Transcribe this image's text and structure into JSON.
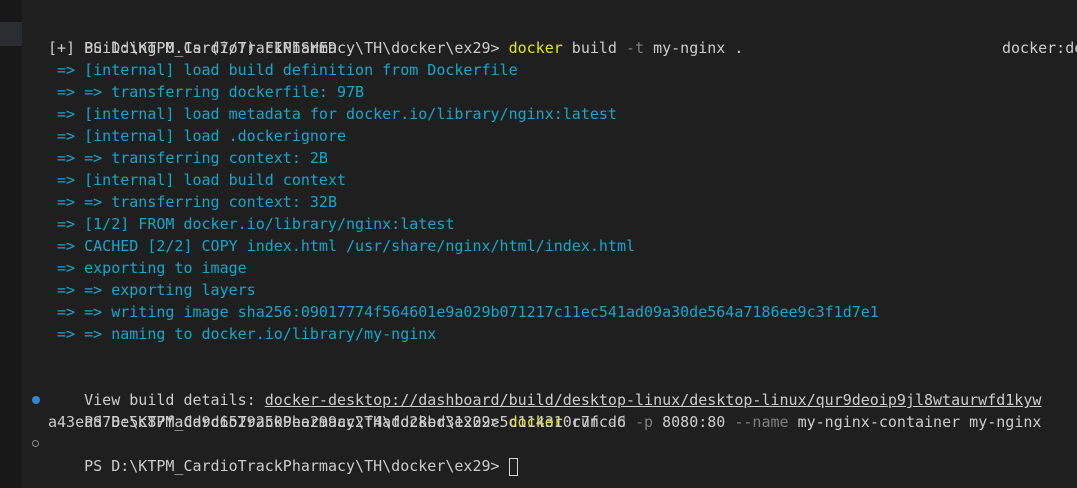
{
  "prompt1": {
    "path": "PS D:\\KTPM_CardioTrackPharmacy\\TH\\docker\\ex29> ",
    "cmd": "docker",
    "args1": " build ",
    "flag": "-t",
    "args2": " my-nginx ."
  },
  "build_status": "[+] Building 0.1s (7/7) FINISHED",
  "builder_label": "docker:de",
  "build_steps": [
    " => [internal] load build definition from Dockerfile",
    " => => transferring dockerfile: 97B",
    " => [internal] load metadata for docker.io/library/nginx:latest",
    " => [internal] load .dockerignore",
    " => => transferring context: 2B",
    " => [internal] load build context",
    " => => transferring context: 32B",
    " => [1/2] FROM docker.io/library/nginx:latest",
    " => CACHED [2/2] COPY index.html /usr/share/nginx/html/index.html",
    " => exporting to image",
    " => => exporting layers",
    " => => writing image sha256:09017774f564601e9a029b071217c11ec541ad09a30de564a7186ee9c3f1d7e1",
    " => => naming to docker.io/library/my-nginx"
  ],
  "view_details": {
    "label": "View build details: ",
    "url": "docker-desktop://dashboard/build/desktop-linux/desktop-linux/qur9deoip9jl8wtaurwfd1kyw"
  },
  "prompt2": {
    "path": "PS D:\\KTPM_CardioTrackPharmacy\\TH\\docker\\ex29> ",
    "cmd": "docker",
    "args1": " run ",
    "flag1": "-d",
    "flag2": "-p",
    "args2": " 8080:80 ",
    "flag3": "--name",
    "args3": " my-nginx-container my-nginx"
  },
  "container_id": "a43ead78e5c87fadd9c65292509ee299ac2f4afd28bd31202c5c114310c7fcd6",
  "prompt3": {
    "path": "PS D:\\KTPM_CardioTrackPharmacy\\TH\\docker\\ex29> "
  },
  "icons": {
    "success_marker": "filled-circle",
    "idle_marker": "hollow-circle",
    "cursor": "block-cursor"
  },
  "colors": {
    "background": "#1f1f1f",
    "command": "#e5e510",
    "flag": "#7f7f7f",
    "output": "#11a8cd",
    "marker": "#2f87d6"
  }
}
